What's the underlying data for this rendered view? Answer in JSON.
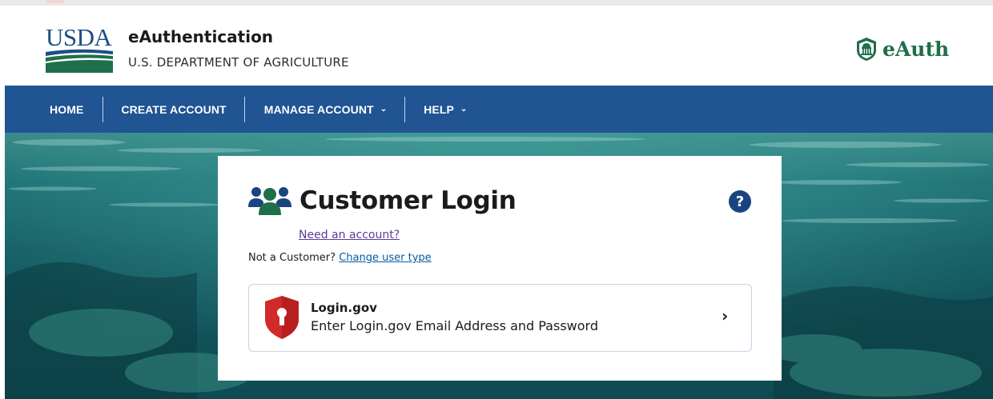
{
  "header": {
    "logo_text": "USDA",
    "title": "eAuthentication",
    "subtitle": "U.S. DEPARTMENT OF AGRICULTURE",
    "brand_logo_text": "eAuth"
  },
  "nav": {
    "items": [
      {
        "label": "HOME"
      },
      {
        "label": "CREATE ACCOUNT"
      },
      {
        "label": "MANAGE ACCOUNT",
        "chevron": "⌄"
      },
      {
        "label": "HELP",
        "chevron": "⌄"
      }
    ]
  },
  "login": {
    "title": "Customer Login",
    "help_glyph": "?",
    "need_account_link": "Need an account?",
    "not_customer_text": "Not a Customer?",
    "change_user_type_link": "Change user type",
    "option": {
      "title": "Login.gov",
      "description": "Enter Login.gov Email Address and Password",
      "chevron": "›"
    }
  },
  "icons": {
    "users": "users-icon",
    "help": "help-circle-icon",
    "shield": "login-gov-shield-icon",
    "chevron": "chevron-right-icon",
    "capitol": "capitol-icon"
  },
  "colors": {
    "nav_bg": "#205493",
    "usda_blue": "#1a4f84",
    "usda_green": "#1f6f4a",
    "link": "#005ea2",
    "visited_link": "#5b3c99",
    "help_bg": "#1a4480",
    "shield_red": "#d12a2a"
  }
}
